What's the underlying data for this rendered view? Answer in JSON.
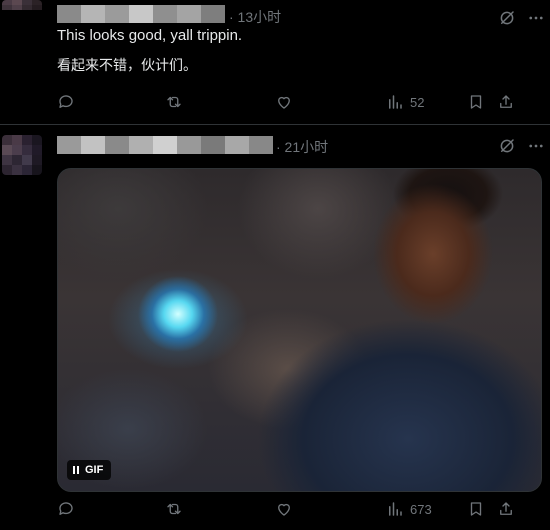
{
  "posts": [
    {
      "time": "· 13小时",
      "text_lines": [
        "This looks good, yall trippin.",
        "看起来不错，伙计们。"
      ],
      "actions": {
        "views": "52"
      }
    },
    {
      "time": "· 21小时",
      "media": {
        "badge_label": "GIF"
      },
      "actions": {
        "views": "673"
      }
    }
  ],
  "icons": {
    "grok": "grok-icon",
    "more": "more-icon",
    "reply": "reply-icon",
    "repost": "repost-icon",
    "like": "heart-icon",
    "views": "views-icon",
    "bookmark": "bookmark-icon",
    "share": "share-icon"
  },
  "colors": {
    "background": "#000000",
    "text": "#e7e9ea",
    "muted": "#71767b",
    "border": "#2f3336"
  }
}
